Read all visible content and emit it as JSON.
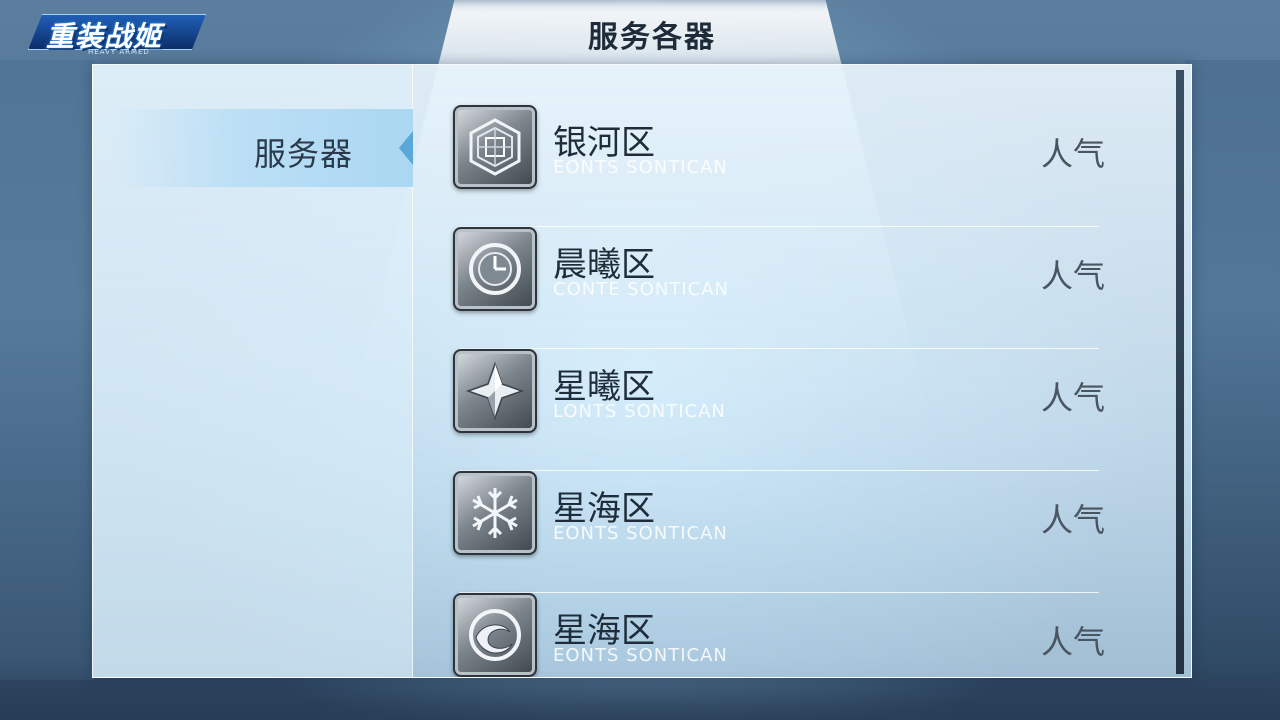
{
  "header": {
    "logo_text": "重装战姬",
    "logo_sub": "HEAVY ARMED",
    "title": "服务各器"
  },
  "sidebar": {
    "tab_label": "服务器"
  },
  "servers": [
    {
      "name": "银河区",
      "subtitle": "EONTS SONTICAN",
      "status": "人气",
      "icon": "hexagon-cube-icon"
    },
    {
      "name": "晨曦区",
      "subtitle": "CONTE SONTICAN",
      "status": "人气",
      "icon": "clock-circle-icon"
    },
    {
      "name": "星曦区",
      "subtitle": "LONTS SONTICAN",
      "status": "人气",
      "icon": "star-icon"
    },
    {
      "name": "星海区",
      "subtitle": "EONTS SONTICAN",
      "status": "人气",
      "icon": "snowflake-icon"
    },
    {
      "name": "星海区",
      "subtitle": "EONTS SONTICAN",
      "status": "人气",
      "icon": "wave-swirl-icon"
    }
  ]
}
